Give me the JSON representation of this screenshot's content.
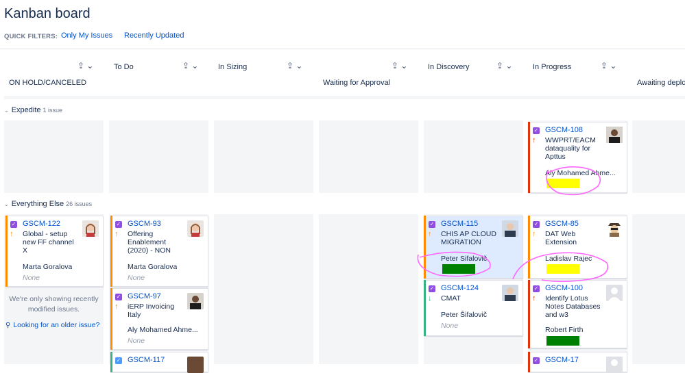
{
  "page": {
    "title": "Kanban board"
  },
  "quick_filters": {
    "label": "QUICK FILTERS:",
    "items": [
      "Only My Issues",
      "Recently Updated"
    ]
  },
  "columns": [
    {
      "name": "ON HOLD/CANCELED"
    },
    {
      "name": "To Do"
    },
    {
      "name": "In Sizing"
    },
    {
      "name": "Waiting for Approval"
    },
    {
      "name": "In Discovery"
    },
    {
      "name": "In Progress"
    },
    {
      "name": "Awaiting deploy"
    }
  ],
  "swimlanes": [
    {
      "name": "Expedite",
      "count": "1 issue"
    },
    {
      "name": "Everything Else",
      "count": "26 issues"
    }
  ],
  "cards": {
    "gscm108": {
      "key": "GSCM-108",
      "summary": "WWPRT/EACM dataquality for Apttus",
      "assignee": "Aly Mohamed Ahme...",
      "priority": "highest"
    },
    "gscm122": {
      "key": "GSCM-122",
      "summary": "Global - setup new FF channel X",
      "assignee": "Marta Goralova",
      "epic": "None",
      "priority": "high"
    },
    "gscm93": {
      "key": "GSCM-93",
      "summary": "Offering Enablement (2020) - NON",
      "assignee": "Marta Goralova",
      "epic": "None",
      "priority": "high"
    },
    "gscm97": {
      "key": "GSCM-97",
      "summary": "iERP Invoicing Italy",
      "assignee": "Aly Mohamed Ahme...",
      "epic": "None",
      "priority": "high"
    },
    "gscm117": {
      "key": "GSCM-117"
    },
    "gscm115": {
      "key": "GSCM-115",
      "summary": "CHIS AP CLOUD MIGRATION",
      "assignee": "Peter Sifalovič",
      "priority": "high"
    },
    "gscm124": {
      "key": "GSCM-124",
      "summary": "CMAT",
      "assignee": "Peter Šifalovič",
      "epic": "None",
      "priority": "low"
    },
    "gscm85": {
      "key": "GSCM-85",
      "summary": "DAT Web Extension",
      "assignee": "Ladislav Rajec",
      "priority": "high"
    },
    "gscm100": {
      "key": "GSCM-100",
      "summary": "Identify Lotus Notes Databases and w3",
      "assignee": "Robert Firth",
      "priority": "highest"
    },
    "gscm17": {
      "key": "GSCM-17"
    }
  },
  "notice": {
    "text": "We're only showing recently modified issues.",
    "link": "Looking for an older issue?"
  },
  "colors": {
    "yellow_flag": "#ffff00",
    "green_flag": "#008000",
    "annotation": "#ff66ff",
    "link": "#0052cc",
    "highest": "#de350b",
    "high": "#ff8b00",
    "low": "#36b37e"
  }
}
